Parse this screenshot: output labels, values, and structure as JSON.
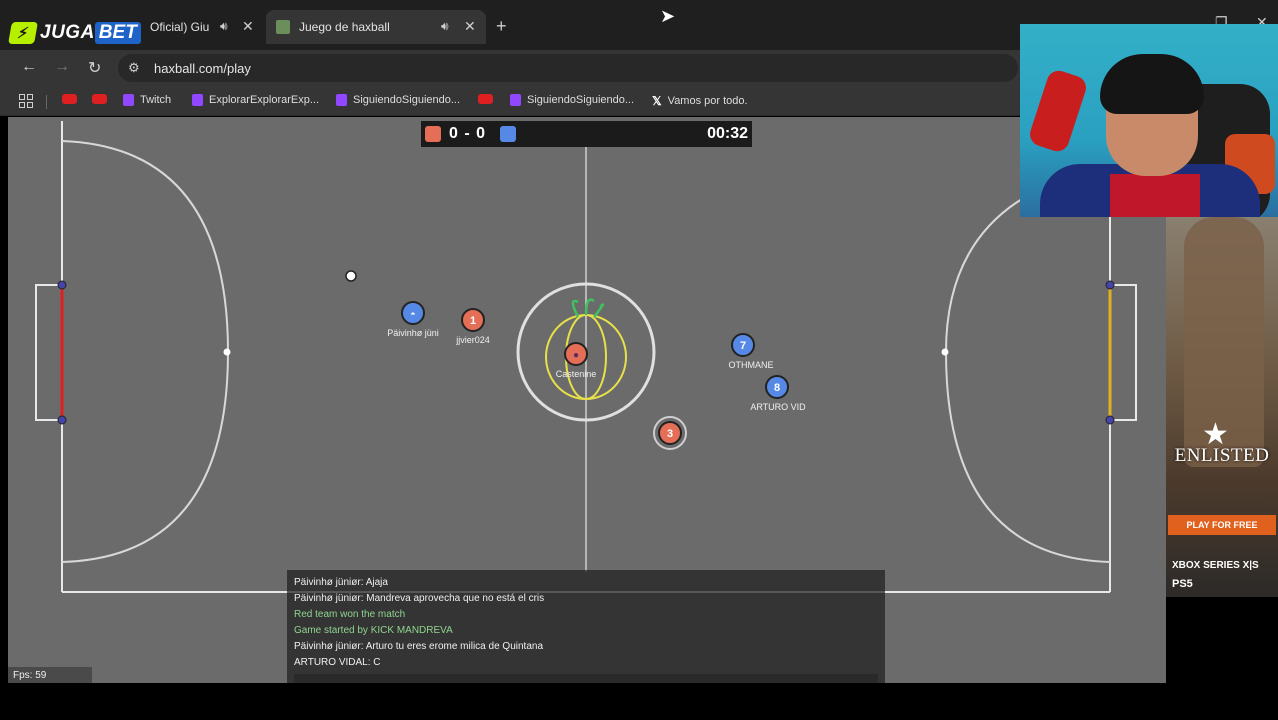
{
  "browser": {
    "tabs": [
      {
        "title": "Oficial) Giuli",
        "active": false
      },
      {
        "title": "Juego de haxball",
        "active": true
      }
    ],
    "new_tab": "+",
    "url": "haxball.com/play",
    "bookmarks": [
      {
        "label": "",
        "icon": "youtube-icon"
      },
      {
        "label": "",
        "icon": "youtube-icon"
      },
      {
        "label": "Twitch",
        "icon": "twitch-icon"
      },
      {
        "label": "ExplorarExplorarExp...",
        "icon": "twitch-icon"
      },
      {
        "label": "SiguiendoSiguiendo...",
        "icon": "twitch-icon"
      },
      {
        "label": "",
        "icon": "youtube-icon"
      },
      {
        "label": "SiguiendoSiguiendo...",
        "icon": "twitch-icon"
      },
      {
        "label": "Vamos por todo.",
        "icon": "x-icon"
      }
    ]
  },
  "overlay_logo": {
    "part1": "JUGA",
    "part2": "BET"
  },
  "game": {
    "score": "0 - 0",
    "time": "00:32",
    "team_colors": {
      "red": "#e56e56",
      "blue": "#5689e5"
    },
    "players": [
      {
        "name": "Päivinhø jüni",
        "team": "blue",
        "number": ""
      },
      {
        "name": "jjvier024",
        "team": "red",
        "number": "1"
      },
      {
        "name": "Castenine",
        "team": "red",
        "number": ""
      },
      {
        "name": "OTHMANE",
        "team": "blue",
        "number": "7"
      },
      {
        "name": "ARTURO VID",
        "team": "blue",
        "number": "8"
      },
      {
        "name": "",
        "team": "red",
        "number": "3"
      }
    ],
    "fps": "Fps: 59"
  },
  "chat": [
    {
      "text": "Päivinhø jüniør: Ajaja",
      "system": false
    },
    {
      "text": "Päivinhø jüniør: Mandreva aprovecha que no está el cris",
      "system": false
    },
    {
      "text": "Red team won the match",
      "system": true
    },
    {
      "text": "Game started by KICK MANDREVA",
      "system": true
    },
    {
      "text": "Päivinhø jüniør: Arturo tu eres erome milica de Quintana",
      "system": false
    },
    {
      "text": "ARTURO VIDAL: C",
      "system": false
    }
  ],
  "ad": {
    "brand": "ENLISTED",
    "cta": "PLAY FOR FREE",
    "platform1": "XBOX SERIES X|S",
    "platform2": "PS5"
  }
}
